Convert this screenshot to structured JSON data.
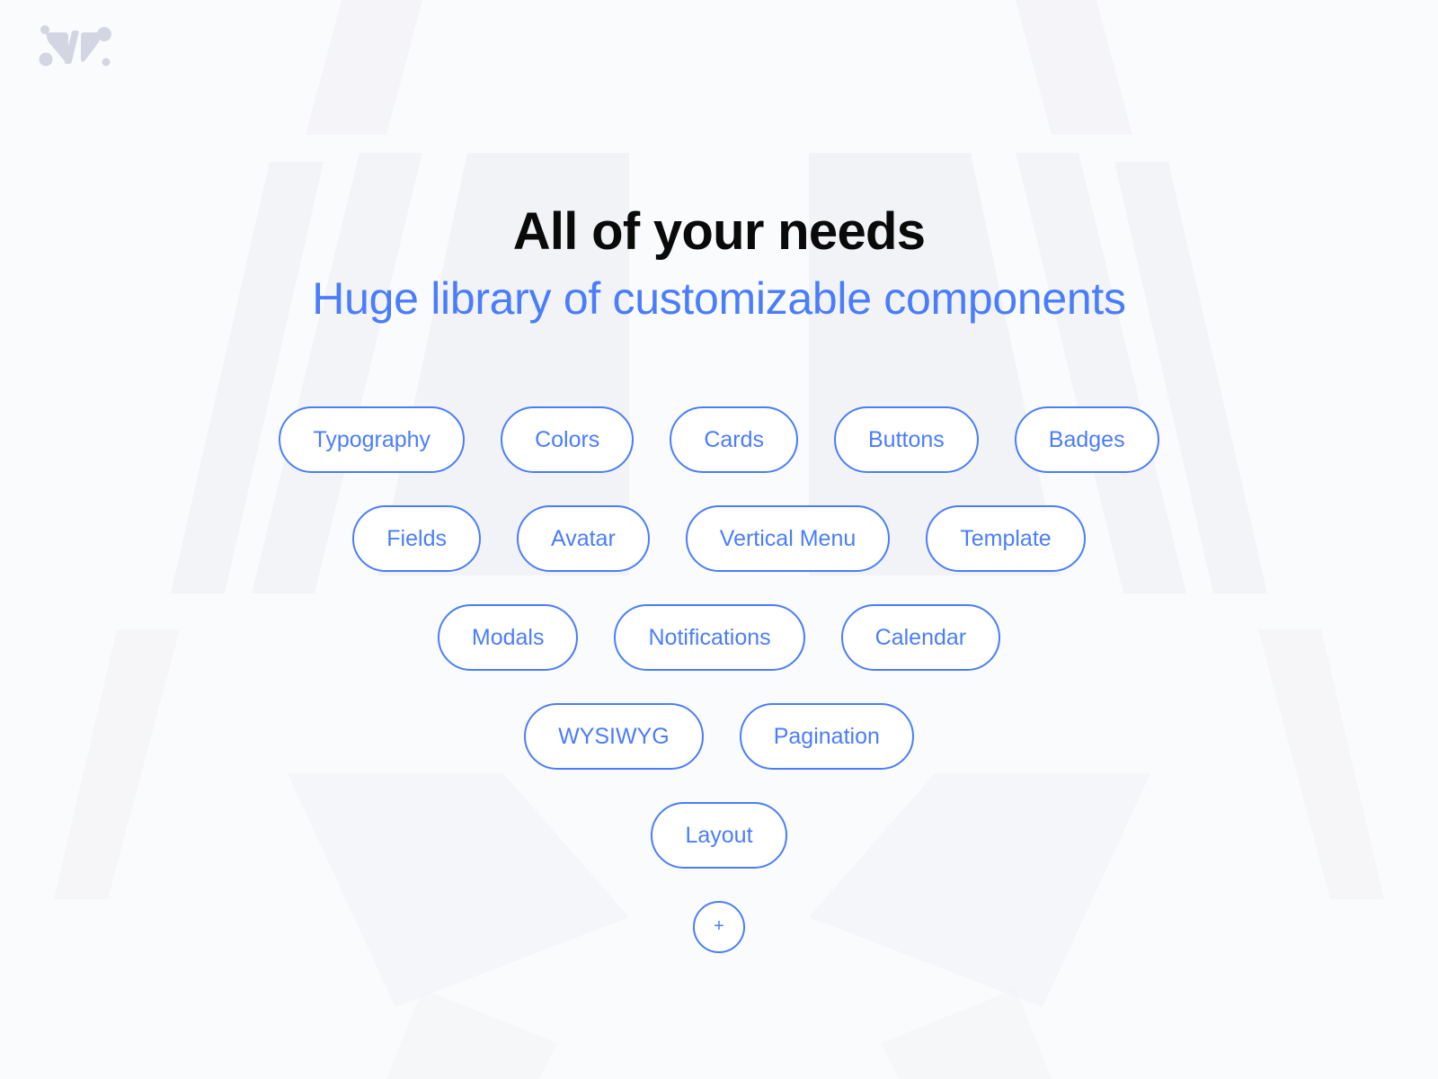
{
  "brand": {
    "logo_icon": "logo-icon",
    "logo_color": "#d4d6e3"
  },
  "header": {
    "title": "All of your needs",
    "subtitle": "Huge library of customizable components"
  },
  "theme": {
    "accent": "#4a7dfc",
    "title_color": "#0a0a0a",
    "background": "#fafbfc",
    "pill_fill": "#ffffff",
    "watermark": "#f2f3f7"
  },
  "components": {
    "rows": [
      {
        "items": [
          {
            "label": "Typography"
          },
          {
            "label": "Colors"
          },
          {
            "label": "Cards"
          },
          {
            "label": "Buttons"
          },
          {
            "label": "Badges"
          }
        ]
      },
      {
        "items": [
          {
            "label": "Fields"
          },
          {
            "label": "Avatar"
          },
          {
            "label": "Vertical Menu"
          },
          {
            "label": "Template"
          }
        ]
      },
      {
        "items": [
          {
            "label": "Modals"
          },
          {
            "label": "Notifications"
          },
          {
            "label": "Calendar"
          }
        ]
      },
      {
        "items": [
          {
            "label": "WYSIWYG"
          },
          {
            "label": "Pagination"
          }
        ]
      },
      {
        "items": [
          {
            "label": "Layout"
          }
        ]
      }
    ],
    "add_more": {
      "label": "+",
      "icon": "plus-icon"
    }
  }
}
